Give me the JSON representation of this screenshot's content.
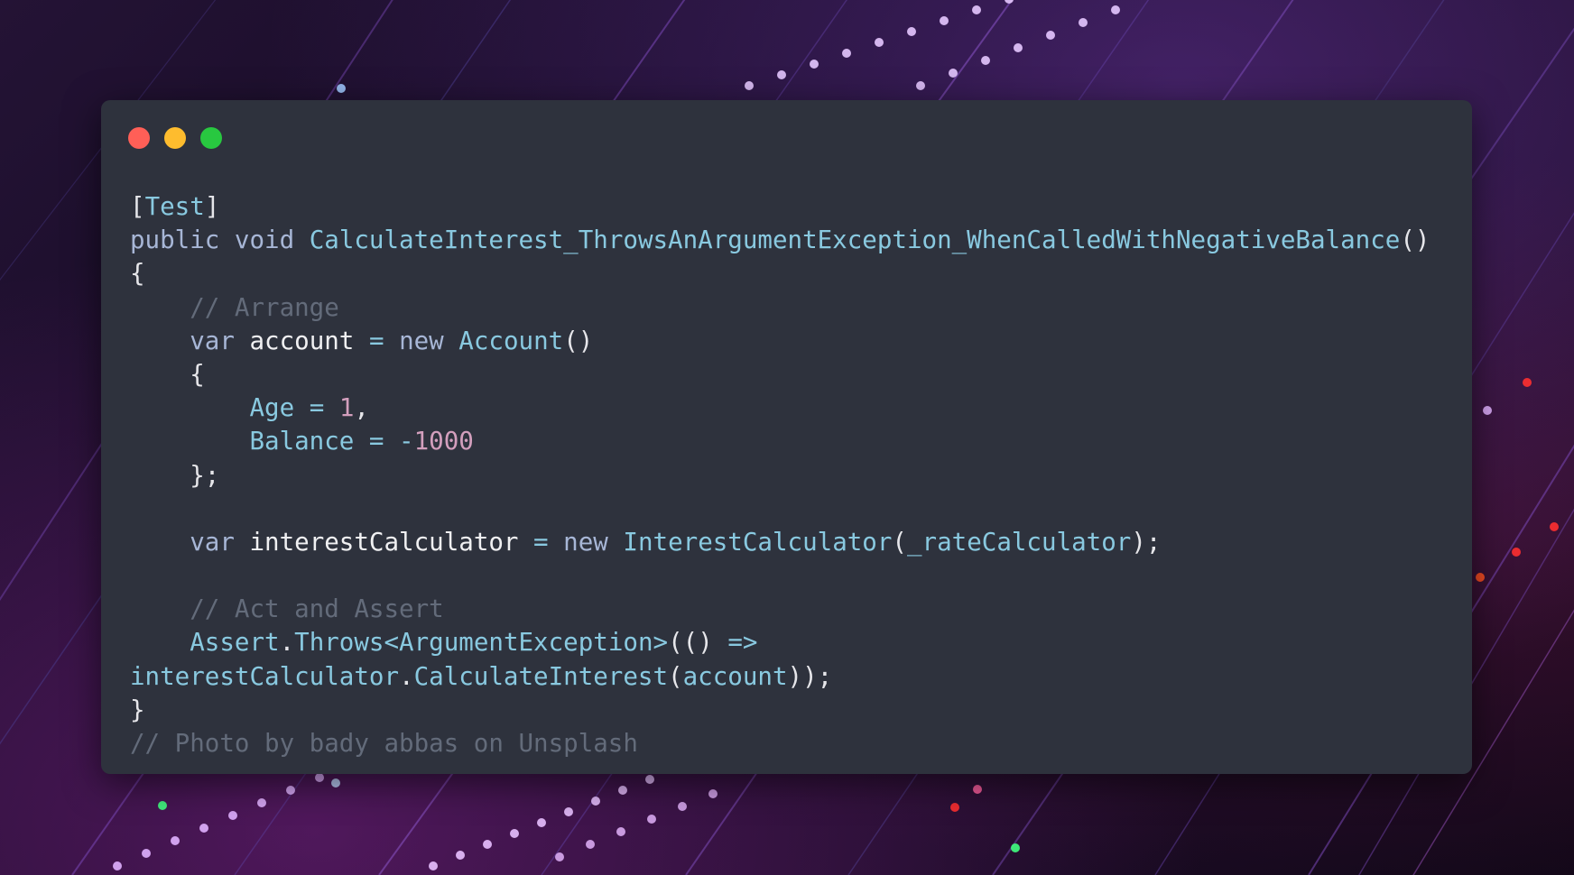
{
  "window": {
    "controls": [
      "close",
      "minimize",
      "maximize"
    ],
    "colors": {
      "close": "#ff5f57",
      "minimize": "#febc2e",
      "maximize": "#28c840",
      "background": "#2e323d"
    }
  },
  "code": {
    "language": "csharp",
    "lines": [
      [
        {
          "t": "[",
          "c": "pn"
        },
        {
          "t": "Test",
          "c": "fn"
        },
        {
          "t": "]",
          "c": "pn"
        }
      ],
      [
        {
          "t": "public",
          "c": "kw"
        },
        {
          "t": " ",
          "c": "pn"
        },
        {
          "t": "void",
          "c": "kw"
        },
        {
          "t": " ",
          "c": "pn"
        },
        {
          "t": "CalculateInterest_ThrowsAnArgumentException_WhenCalledWithNegativeBalance",
          "c": "fn"
        },
        {
          "t": "()",
          "c": "pn"
        }
      ],
      [
        {
          "t": "{",
          "c": "pn"
        }
      ],
      [
        {
          "t": "    ",
          "c": "pn"
        },
        {
          "t": "// Arrange",
          "c": "cm"
        }
      ],
      [
        {
          "t": "    ",
          "c": "pn"
        },
        {
          "t": "var",
          "c": "kw"
        },
        {
          "t": " ",
          "c": "pn"
        },
        {
          "t": "account",
          "c": "id"
        },
        {
          "t": " ",
          "c": "pn"
        },
        {
          "t": "=",
          "c": "op"
        },
        {
          "t": " ",
          "c": "pn"
        },
        {
          "t": "new",
          "c": "kw"
        },
        {
          "t": " ",
          "c": "pn"
        },
        {
          "t": "Account",
          "c": "ty"
        },
        {
          "t": "()",
          "c": "pn"
        }
      ],
      [
        {
          "t": "    {",
          "c": "pn"
        }
      ],
      [
        {
          "t": "        ",
          "c": "pn"
        },
        {
          "t": "Age",
          "c": "fn"
        },
        {
          "t": " ",
          "c": "pn"
        },
        {
          "t": "=",
          "c": "op"
        },
        {
          "t": " ",
          "c": "pn"
        },
        {
          "t": "1",
          "c": "num"
        },
        {
          "t": ",",
          "c": "pn"
        }
      ],
      [
        {
          "t": "        ",
          "c": "pn"
        },
        {
          "t": "Balance",
          "c": "fn"
        },
        {
          "t": " ",
          "c": "pn"
        },
        {
          "t": "=",
          "c": "op"
        },
        {
          "t": " ",
          "c": "pn"
        },
        {
          "t": "-",
          "c": "op"
        },
        {
          "t": "1000",
          "c": "num"
        }
      ],
      [
        {
          "t": "    };",
          "c": "pn"
        }
      ],
      [
        {
          "t": "",
          "c": "pn"
        }
      ],
      [
        {
          "t": "    ",
          "c": "pn"
        },
        {
          "t": "var",
          "c": "kw"
        },
        {
          "t": " ",
          "c": "pn"
        },
        {
          "t": "interestCalculator",
          "c": "id"
        },
        {
          "t": " ",
          "c": "pn"
        },
        {
          "t": "=",
          "c": "op"
        },
        {
          "t": " ",
          "c": "pn"
        },
        {
          "t": "new",
          "c": "kw"
        },
        {
          "t": " ",
          "c": "pn"
        },
        {
          "t": "InterestCalculator",
          "c": "ty"
        },
        {
          "t": "(",
          "c": "pn"
        },
        {
          "t": "_rateCalculator",
          "c": "fn"
        },
        {
          "t": ");",
          "c": "pn"
        }
      ],
      [
        {
          "t": "",
          "c": "pn"
        }
      ],
      [
        {
          "t": "    ",
          "c": "pn"
        },
        {
          "t": "// Act and Assert",
          "c": "cm"
        }
      ],
      [
        {
          "t": "    ",
          "c": "pn"
        },
        {
          "t": "Assert",
          "c": "fn"
        },
        {
          "t": ".",
          "c": "pn"
        },
        {
          "t": "Throws",
          "c": "fn"
        },
        {
          "t": "<",
          "c": "op"
        },
        {
          "t": "ArgumentException",
          "c": "ty"
        },
        {
          "t": ">",
          "c": "op"
        },
        {
          "t": "(() ",
          "c": "pn"
        },
        {
          "t": "=>",
          "c": "op"
        }
      ],
      [
        {
          "t": "interestCalculator",
          "c": "fn"
        },
        {
          "t": ".",
          "c": "pn"
        },
        {
          "t": "CalculateInterest",
          "c": "fn"
        },
        {
          "t": "(",
          "c": "pn"
        },
        {
          "t": "account",
          "c": "fn"
        },
        {
          "t": "));",
          "c": "pn"
        }
      ],
      [
        {
          "t": "}",
          "c": "pn"
        }
      ],
      [
        {
          "t": "// Photo by bady abbas on Unsplash",
          "c": "cm"
        }
      ]
    ]
  }
}
